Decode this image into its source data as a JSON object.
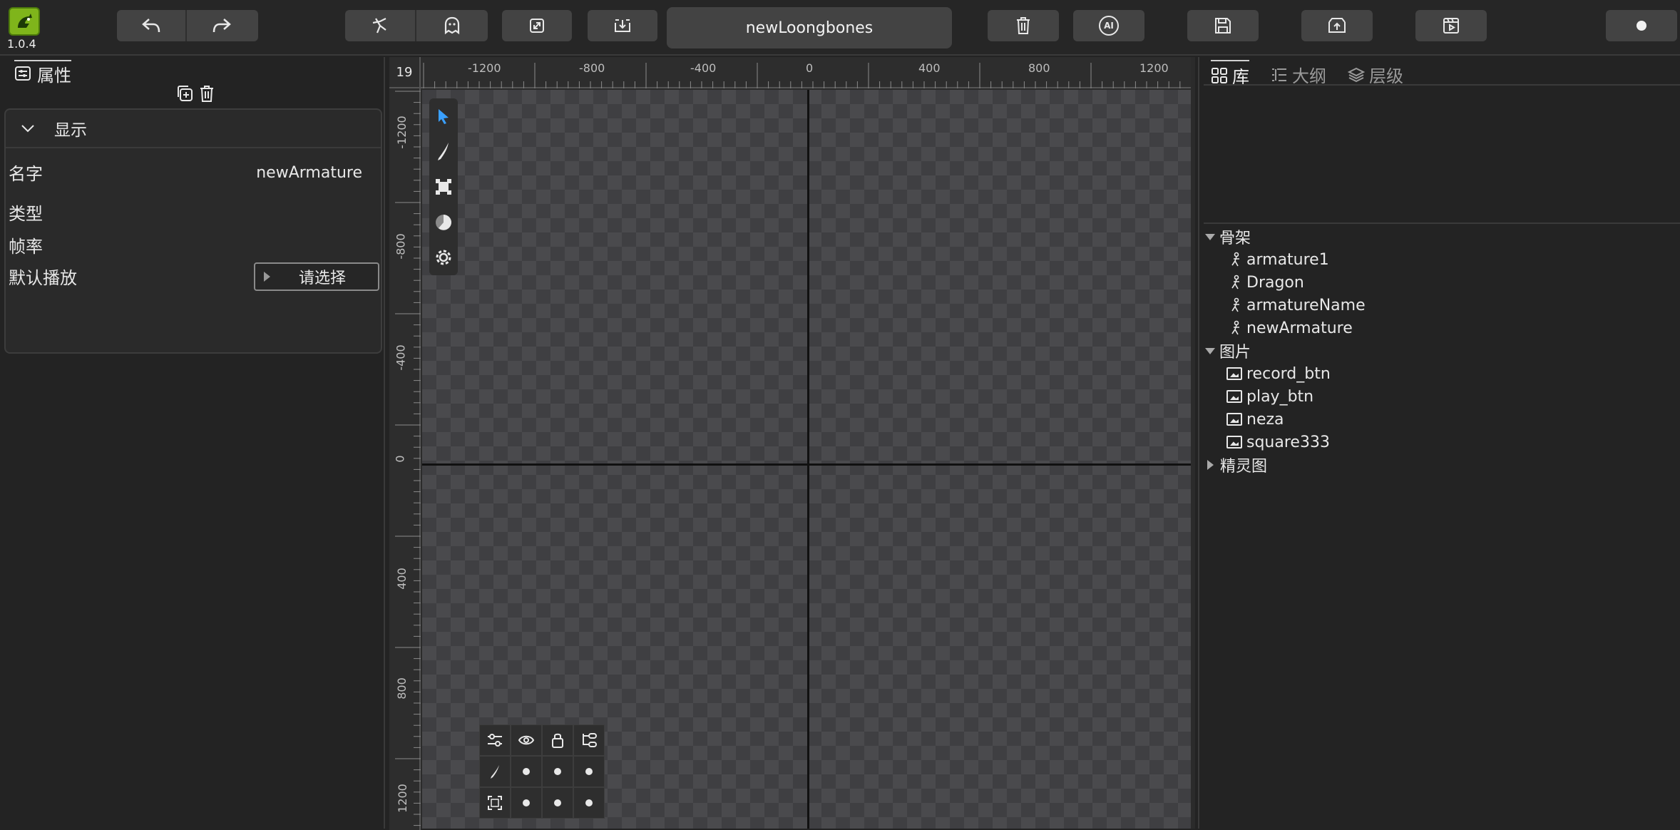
{
  "app": {
    "version": "1.0.4",
    "project_title": "newLoongbones"
  },
  "toolbar": {
    "undo_icon": "undo-icon",
    "redo_icon": "redo-icon",
    "bone_icon": "bone-tool-icon",
    "ghost_icon": "ghost-icon",
    "fit_icon": "expand-icon",
    "import_icon": "import-icon",
    "delete_icon": "trash-icon",
    "ai_label": "AI",
    "save_icon": "save-icon",
    "export_icon": "export-icon",
    "preview_icon": "preview-icon"
  },
  "left_panel": {
    "tab_label": "属性",
    "section_title": "显示",
    "props": {
      "name_label": "名字",
      "name_value": "newArmature",
      "type_label": "类型",
      "framerate_label": "帧率",
      "default_play_label": "默认播放",
      "default_play_value": "请选择"
    }
  },
  "canvas": {
    "zoom": "19",
    "ruler_x_labels": [
      "-1200",
      "-800",
      "-400",
      "0",
      "400",
      "800",
      "1200"
    ],
    "ruler_y_labels": [
      "-1200",
      "-800",
      "-400",
      "0",
      "400",
      "800",
      "1200"
    ]
  },
  "right_panel": {
    "tabs": [
      {
        "label": "库",
        "icon": "grid-icon"
      },
      {
        "label": "大纲",
        "icon": "outline-icon"
      },
      {
        "label": "层级",
        "icon": "layers-icon"
      }
    ],
    "tree": {
      "armature_group": "骨架",
      "armatures": [
        "armature1",
        "Dragon",
        "armatureName",
        "newArmature"
      ],
      "image_group": "图片",
      "images": [
        "record_btn",
        "play_btn",
        "neza",
        "square333"
      ],
      "sprite_group": "精灵图"
    }
  },
  "colors": {
    "accent": "#3aa0ff",
    "logo": "#7fb51b"
  }
}
